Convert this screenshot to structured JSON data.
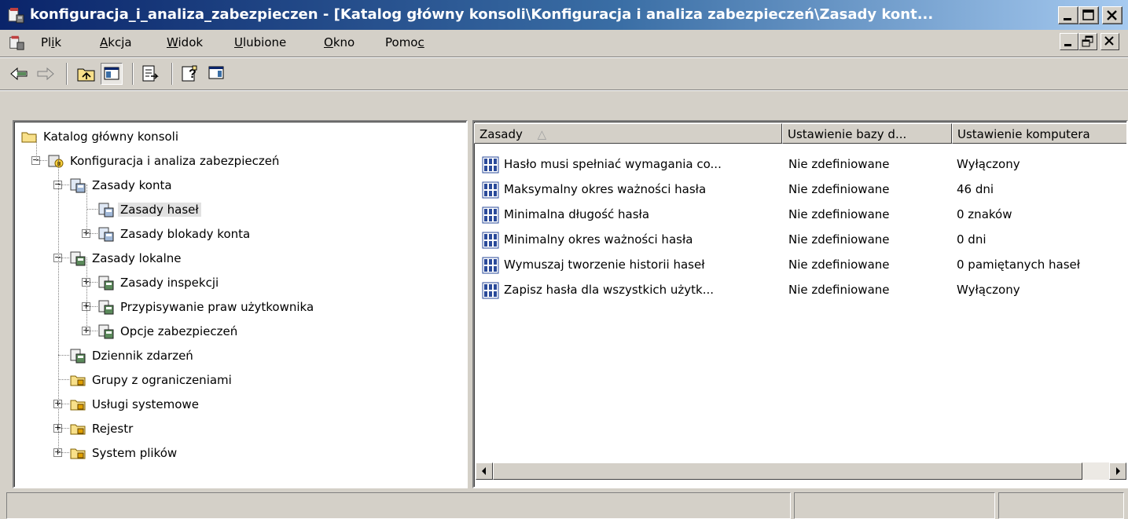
{
  "window": {
    "title": "konfiguracja_i_analiza_zabezpieczen - [Katalog główny konsoli\\Konfiguracja i analiza zabezpieczeń\\Zasady kont...",
    "controls": {
      "minimize": "_",
      "maximize": "□",
      "close": "×"
    }
  },
  "menubar": {
    "items": [
      {
        "label": "Plik",
        "accel": "i"
      },
      {
        "label": "Akcja",
        "accel": "A"
      },
      {
        "label": "Widok",
        "accel": "W"
      },
      {
        "label": "Ulubione",
        "accel": "U"
      },
      {
        "label": "Okno",
        "accel": "O"
      },
      {
        "label": "Pomoc",
        "accel": "c"
      }
    ],
    "mdi_controls": {
      "minimize": "_",
      "restore": "❐",
      "close": "×"
    }
  },
  "toolbar": {
    "buttons": [
      "back-icon",
      "forward-icon",
      "up-one-level-icon",
      "show-hide-tree-icon",
      "export-list-icon",
      "help-icon",
      "show-hide-action-pane-icon"
    ]
  },
  "tree": {
    "items": [
      {
        "label": "Katalog główny konsoli",
        "icon": "folder-icon",
        "level": 0,
        "expander": "none"
      },
      {
        "label": "Konfiguracja i analiza zabezpieczeń",
        "icon": "security-config-icon",
        "level": 1,
        "expander": "minus"
      },
      {
        "label": "Zasady konta",
        "icon": "policy-folder-icon",
        "level": 2,
        "expander": "minus"
      },
      {
        "label": "Zasady haseł",
        "icon": "policy-folder-icon",
        "level": 3,
        "expander": "none",
        "selected": true
      },
      {
        "label": "Zasady blokady konta",
        "icon": "policy-folder-icon",
        "level": 3,
        "expander": "plus"
      },
      {
        "label": "Zasady lokalne",
        "icon": "policy-computer-icon",
        "level": 2,
        "expander": "minus"
      },
      {
        "label": "Zasady inspekcji",
        "icon": "policy-computer-icon",
        "level": 3,
        "expander": "plus"
      },
      {
        "label": "Przypisywanie praw użytkownika",
        "icon": "policy-computer-icon",
        "level": 3,
        "expander": "plus"
      },
      {
        "label": "Opcje zabezpieczeń",
        "icon": "policy-computer-icon",
        "level": 3,
        "expander": "plus"
      },
      {
        "label": "Dziennik zdarzeń",
        "icon": "policy-computer-icon",
        "level": 2,
        "expander": "none"
      },
      {
        "label": "Grupy z ograniczeniami",
        "icon": "locked-folder-icon",
        "level": 2,
        "expander": "none"
      },
      {
        "label": "Usługi systemowe",
        "icon": "locked-folder-icon",
        "level": 2,
        "expander": "plus"
      },
      {
        "label": "Rejestr",
        "icon": "locked-folder-icon",
        "level": 2,
        "expander": "plus"
      },
      {
        "label": "System plików",
        "icon": "locked-folder-icon",
        "level": 2,
        "expander": "plus"
      }
    ]
  },
  "list": {
    "columns": [
      "Zasady",
      "Ustawienie bazy d...",
      "Ustawienie komputera"
    ],
    "sort_indicator": "△",
    "rows": [
      {
        "policy": "Hasło musi spełniać wymagania co...",
        "db": "Nie zdefiniowane",
        "computer": "Wyłączony"
      },
      {
        "policy": "Maksymalny okres ważności hasła",
        "db": "Nie zdefiniowane",
        "computer": "46 dni"
      },
      {
        "policy": "Minimalna długość hasła",
        "db": "Nie zdefiniowane",
        "computer": "0 znaków"
      },
      {
        "policy": "Minimalny okres ważności hasła",
        "db": "Nie zdefiniowane",
        "computer": "0 dni"
      },
      {
        "policy": "Wymuszaj tworzenie historii haseł",
        "db": "Nie zdefiniowane",
        "computer": "0 pamiętanych haseł"
      },
      {
        "policy": "Zapisz hasła dla wszystkich użytk...",
        "db": "Nie zdefiniowane",
        "computer": "Wyłączony"
      }
    ],
    "row_icon": "policy-setting-icon"
  },
  "statusbar": {
    "panels": [
      "",
      "",
      ""
    ]
  }
}
